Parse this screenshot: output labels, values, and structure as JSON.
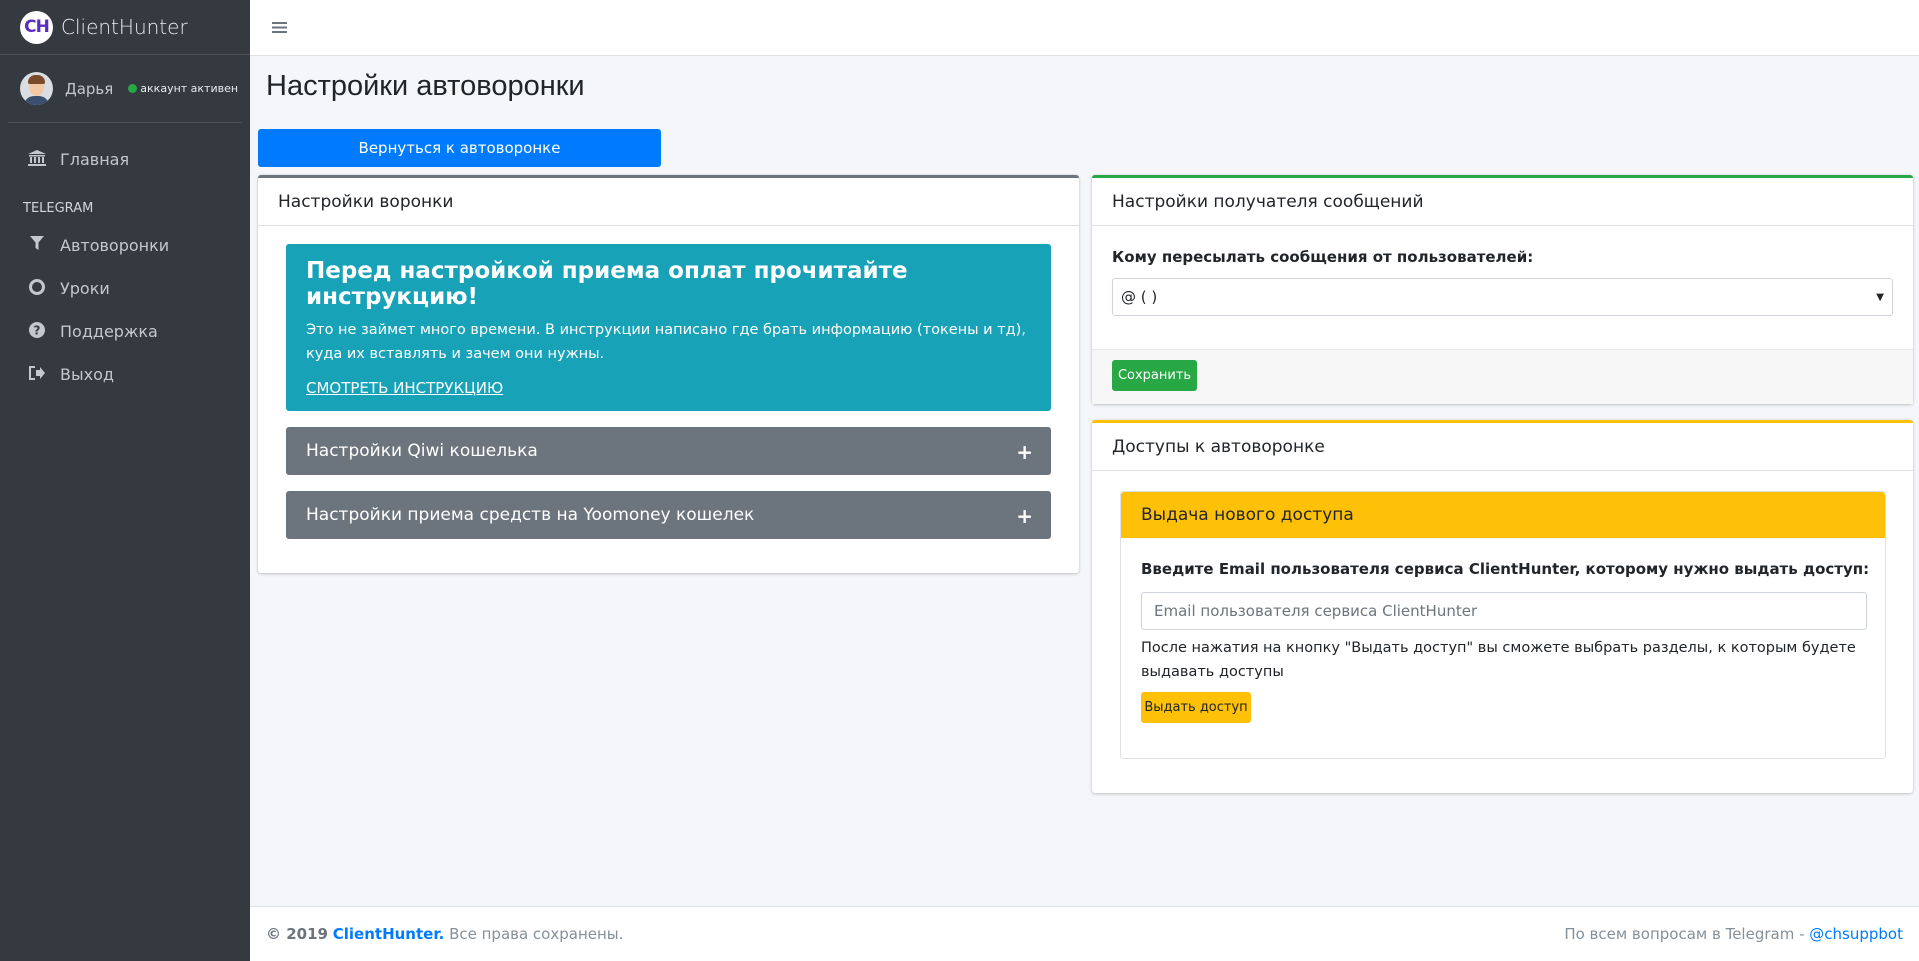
{
  "brand": {
    "logo": "CH",
    "name": "ClientHunter"
  },
  "user": {
    "name": "Дарья",
    "status": "аккаунт активен"
  },
  "sidebar": {
    "items_top": [
      {
        "label": "Главная",
        "icon": "bank-icon"
      }
    ],
    "section_header": "TELEGRAM",
    "items": [
      {
        "label": "Автоворонки",
        "icon": "filter-icon"
      },
      {
        "label": "Уроки",
        "icon": "lifebuoy-icon"
      },
      {
        "label": "Поддержка",
        "icon": "question-circle-icon"
      },
      {
        "label": "Выход",
        "icon": "sign-out-icon"
      }
    ]
  },
  "page": {
    "title": "Настройки автоворонки",
    "back_button": "Вернуться к автоворонке"
  },
  "funnel_settings": {
    "header": "Настройки воронки",
    "callout": {
      "title": "Перед настройкой приема оплат прочитайте инструкцию!",
      "text": "Это не займет много времени. В инструкции написано где брать информацию (токены и тд), куда их вставлять и зачем они нужны.",
      "link": "СМОТРЕТЬ ИНСТРУКЦИЮ"
    },
    "sections": [
      {
        "label": "Настройки Qiwi кошелька"
      },
      {
        "label": "Настройки приема средств на Yoomoney кошелек"
      }
    ]
  },
  "recipient_settings": {
    "header": "Настройки получателя сообщений",
    "field_label": "Кому пересылать сообщения от пользователей:",
    "selected_value": "@ ( )",
    "save_button": "Сохранить"
  },
  "access_settings": {
    "header": "Доступы к автоворонке",
    "panel_title": "Выдача нового доступа",
    "field_label": "Введите Email пользователя сервиса ClientHunter, которому нужно выдать доступ:",
    "email_placeholder": "Email пользователя сервиса ClientHunter",
    "help_text": "После нажатия на кнопку \"Выдать доступ\" вы сможете выбрать разделы, к которым будете выдавать доступы",
    "grant_button": "Выдать доступ"
  },
  "footer": {
    "copyright_year": "© 2019",
    "brand": "ClientHunter.",
    "rights": "Все права сохранены.",
    "support_text": "По всем вопросам в Telegram -",
    "support_link": "@chsuppbot"
  },
  "colors": {
    "sidebar_bg": "#343a40",
    "primary": "#007bff",
    "info": "#17a2b8",
    "secondary": "#6c757d",
    "success": "#28a745",
    "warning": "#ffc107"
  }
}
